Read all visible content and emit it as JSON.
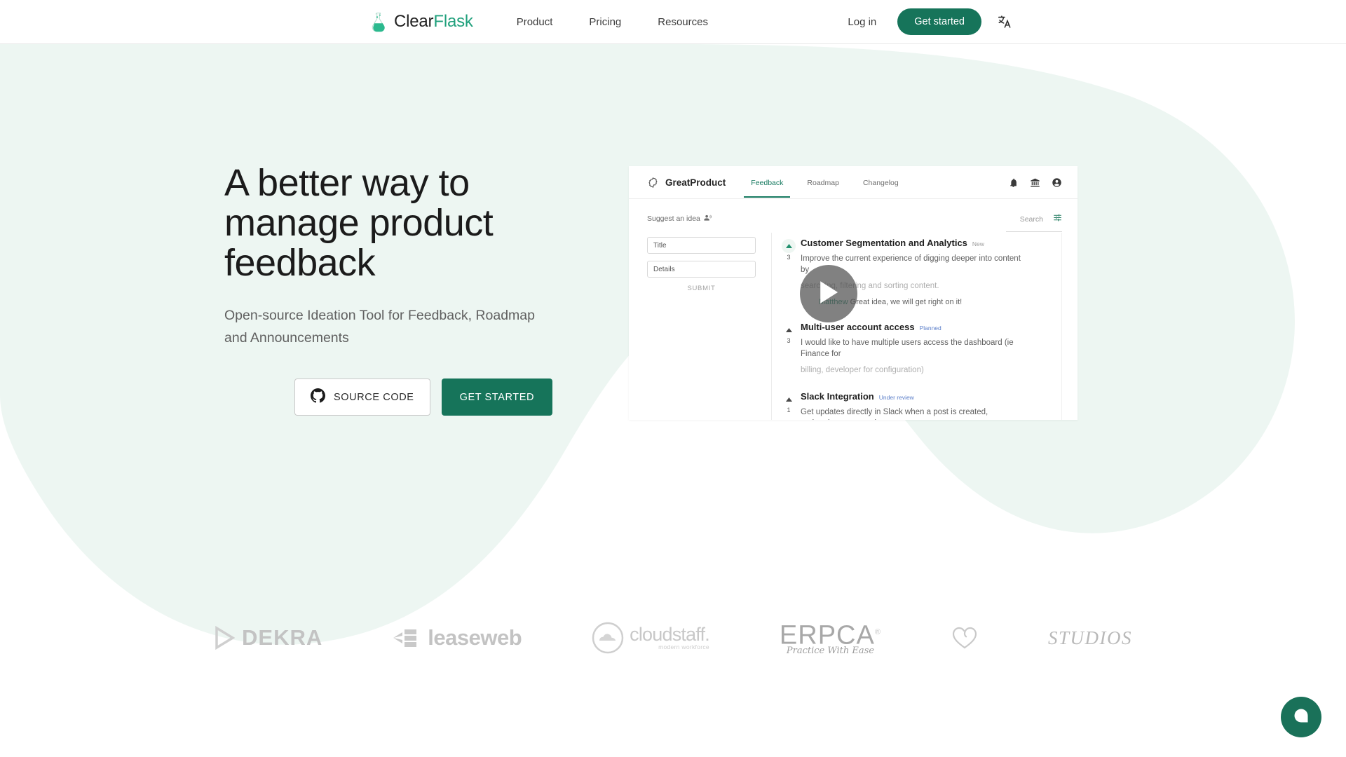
{
  "navbar": {
    "brand": {
      "name_part1": "Clear",
      "name_part2": "Flask",
      "icon": "flask-icon"
    },
    "links": [
      {
        "label": "Product",
        "name": "nav-link-product"
      },
      {
        "label": "Pricing",
        "name": "nav-link-pricing"
      },
      {
        "label": "Resources",
        "name": "nav-link-resources"
      }
    ],
    "login_label": "Log in",
    "get_started_label": "Get started",
    "language_icon": "translate-icon"
  },
  "hero": {
    "title": "A better way to manage product feedback",
    "subtitle": "Open-source Ideation Tool for Feedback, Roadmap and Announcements",
    "source_code_label": "SOURCE CODE",
    "source_code_icon": "github-icon",
    "get_started_label": "GET STARTED"
  },
  "app_preview": {
    "product_name": "GreatProduct",
    "product_icon": "gear-outline-icon",
    "tabs": [
      {
        "label": "Feedback",
        "active": true
      },
      {
        "label": "Roadmap",
        "active": false
      },
      {
        "label": "Changelog",
        "active": false
      }
    ],
    "header_icons": [
      "bell-icon",
      "bank-icon",
      "account-circle-icon"
    ],
    "suggest_label": "Suggest an idea",
    "suggest_icon": "megaphone-person-icon",
    "search_label": "Search",
    "filter_icon": "filter-settings-icon",
    "form": {
      "title_placeholder": "Title",
      "details_placeholder": "Details",
      "submit_label": "SUBMIT"
    },
    "posts": [
      {
        "votes": "3",
        "voted": true,
        "title": "Customer Segmentation and Analytics",
        "badge": "New",
        "badge_kind": "new",
        "description": "Improve the current experience of digging deeper into content by",
        "description2": "searching, filtering and sorting content.",
        "reply_author": "Matthew",
        "reply_text": "Great idea, we will get right on it!"
      },
      {
        "votes": "3",
        "voted": false,
        "title": "Multi-user account access",
        "badge": "Planned",
        "badge_kind": "planned",
        "description": "I would like to have multiple users access the dashboard (ie Finance for",
        "description2": "billing, developer for configuration)"
      },
      {
        "votes": "1",
        "voted": false,
        "title": "Slack Integration",
        "badge": "Under review",
        "badge_kind": "review",
        "description": "Get updates directly in Slack when a post is created, updated, commented",
        "description2": ""
      }
    ],
    "play_button_icon": "play-icon"
  },
  "logos": [
    {
      "name": "dekra",
      "text": "DEKRA"
    },
    {
      "name": "leaseweb",
      "text": "leaseweb"
    },
    {
      "name": "cloudstaff",
      "text": "cloudstaff.",
      "sub": "modern workforce"
    },
    {
      "name": "erpca",
      "text": "ERPCA",
      "sub": "Practice With Ease",
      "reg": "®"
    },
    {
      "name": "heart-logo",
      "text": ""
    },
    {
      "name": "studios",
      "text": "STUDIOS"
    }
  ],
  "chat": {
    "icon": "chat-bubble-icon"
  },
  "colors": {
    "brand_green": "#20a07c",
    "cta_green": "#16745a",
    "hero_bg": "#edf6f2",
    "badge_blue": "#5b7ec9"
  }
}
